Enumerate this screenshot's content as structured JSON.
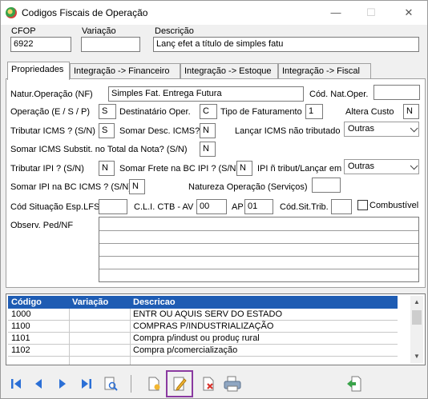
{
  "window": {
    "title": "Codigos Fiscais de Operação",
    "minimize": "—",
    "maximize": "☐",
    "close": "✕"
  },
  "header": {
    "cfop_label": "CFOP",
    "cfop_value": "6922",
    "variacao_label": "Variação",
    "variacao_value": "",
    "descricao_label": "Descrição",
    "descricao_value": "Lanç efet a título de simples fatu"
  },
  "tabs": [
    "Propriedades",
    "Integração -> Financeiro",
    "Integração -> Estoque",
    "Integração -> Fiscal"
  ],
  "props": {
    "natur_label": "Natur.Operação (NF)",
    "natur_value": "Simples Fat. Entrega Futura",
    "cod_nat_label": "Cód. Nat.Oper.",
    "cod_nat_value": "",
    "operacao_label": "Operação (E / S / P)",
    "operacao_value": "S",
    "destinatario_label": "Destinatário Oper.",
    "destinatario_value": "C",
    "tipo_fat_label": "Tipo de Faturamento",
    "tipo_fat_value": "1",
    "altera_custo_label": "Altera Custo",
    "altera_custo_value": "N",
    "tributar_icms_label": "Tributar ICMS ? (S/N)",
    "tributar_icms_value": "S",
    "somar_desc_label": "Somar Desc. ICMS?",
    "somar_desc_value": "N",
    "lancar_icms_label": "Lançar ICMS não tributado",
    "lancar_icms_value": "Outras",
    "somar_icms_st_label": "Somar ICMS Substit. no Total da Nota? (S/N)",
    "somar_icms_st_value": "N",
    "tributar_ipi_label": "Tributar IPI ? (S/N)",
    "tributar_ipi_value": "N",
    "somar_frete_label": "Somar Frete na BC IPI ? (S/N)",
    "somar_frete_value": "N",
    "ipi_nao_trib_label": "IPI ñ tribut/Lançar em",
    "ipi_nao_trib_value": "Outras",
    "somar_ipi_label": "Somar IPI na BC ICMS ? (S/N)",
    "somar_ipi_value": "N",
    "natureza_servicos_label": "Natureza Operação (Serviços)",
    "natureza_servicos_value": "",
    "cod_situacao_label": "Cód Situação Esp.LFS",
    "cod_situacao_value": "",
    "cli_ctb_label": "C.L.I. CTB - AV",
    "cli_ctb_value": "00",
    "ap_label": "AP",
    "ap_value": "01",
    "cod_sit_trib_label": "Cód.Sit.Trib.",
    "cod_sit_trib_value": "",
    "combustivel_label": "Combustível",
    "observ_label": "Observ. Ped/NF"
  },
  "grid": {
    "columns": [
      "Código",
      "Variação",
      "Descricao"
    ],
    "rows": [
      [
        "1000",
        "",
        "ENTR OU AQUIS SERV DO ESTADO"
      ],
      [
        "1100",
        "",
        "COMPRAS P/INDUSTRIALIZAÇÃO"
      ],
      [
        "1101",
        "",
        "Compra p/indust ou produç rural"
      ],
      [
        "1102",
        "",
        "Compra p/comercialização"
      ]
    ]
  },
  "colors": {
    "grid_header": "#1e5cb3",
    "nav_blue": "#2b6fd6",
    "selected_border": "#8a3aa0"
  }
}
